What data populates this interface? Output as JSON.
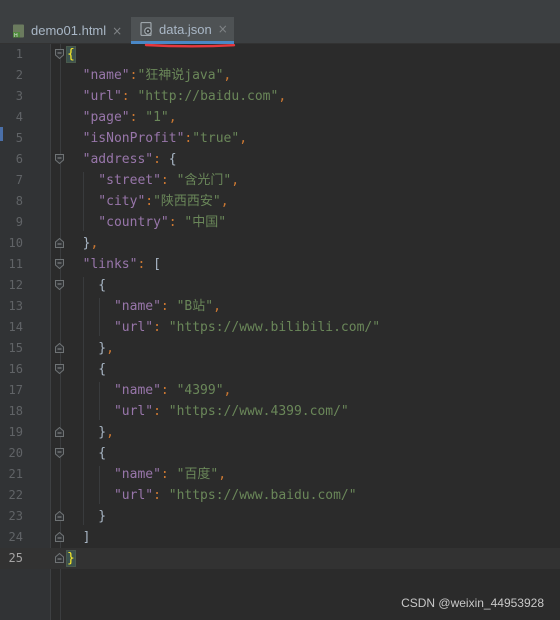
{
  "tabs": [
    {
      "label": "demo01.html",
      "close": "×",
      "icon": "html-file-icon",
      "active": false
    },
    {
      "label": "data.json",
      "close": "×",
      "icon": "json-file-icon",
      "active": true
    }
  ],
  "colors": {
    "background": "#2b2b2b",
    "key": "#9876aa",
    "string": "#6a8759",
    "punctuation": "#cc7832",
    "bracket": "#a9b7c6",
    "line_number": "#606366",
    "accent": "#4a88c7",
    "annotation": "#e8373d"
  },
  "editor": {
    "current_line": 25,
    "lines": [
      {
        "n": "1",
        "fold": "open",
        "tokens": [
          [
            "bm",
            "{"
          ]
        ]
      },
      {
        "n": "2",
        "tokens": [
          [
            "k",
            "  \"name\""
          ],
          [
            "p",
            ":"
          ],
          [
            "s",
            "\"狂神说java\""
          ],
          [
            "p",
            ","
          ]
        ]
      },
      {
        "n": "3",
        "tokens": [
          [
            "k",
            "  \"url\""
          ],
          [
            "p",
            ": "
          ],
          [
            "s",
            "\"http://baidu.com\""
          ],
          [
            "p",
            ","
          ]
        ]
      },
      {
        "n": "4",
        "tokens": [
          [
            "k",
            "  \"page\""
          ],
          [
            "p",
            ": "
          ],
          [
            "s",
            "\"1\""
          ],
          [
            "p",
            ","
          ]
        ]
      },
      {
        "n": "5",
        "tokens": [
          [
            "k",
            "  \"isNonProfit\""
          ],
          [
            "p",
            ":"
          ],
          [
            "s",
            "\"true\""
          ],
          [
            "p",
            ","
          ]
        ]
      },
      {
        "n": "6",
        "fold": "open",
        "tokens": [
          [
            "k",
            "  \"address\""
          ],
          [
            "p",
            ": "
          ],
          [
            "b",
            "{"
          ]
        ]
      },
      {
        "n": "7",
        "tokens": [
          [
            "k",
            "    \"street\""
          ],
          [
            "p",
            ": "
          ],
          [
            "s",
            "\"含光门\""
          ],
          [
            "p",
            ","
          ]
        ]
      },
      {
        "n": "8",
        "tokens": [
          [
            "k",
            "    \"city\""
          ],
          [
            "p",
            ":"
          ],
          [
            "s",
            "\"陕西西安\""
          ],
          [
            "p",
            ","
          ]
        ]
      },
      {
        "n": "9",
        "tokens": [
          [
            "k",
            "    \"country\""
          ],
          [
            "p",
            ": "
          ],
          [
            "s",
            "\"中国\""
          ]
        ]
      },
      {
        "n": "10",
        "fold": "close",
        "tokens": [
          [
            "b",
            "  }"
          ],
          [
            "p",
            ","
          ]
        ]
      },
      {
        "n": "11",
        "fold": "open",
        "tokens": [
          [
            "k",
            "  \"links\""
          ],
          [
            "p",
            ": "
          ],
          [
            "b",
            "["
          ]
        ]
      },
      {
        "n": "12",
        "fold": "open",
        "tokens": [
          [
            "b",
            "    {"
          ]
        ]
      },
      {
        "n": "13",
        "tokens": [
          [
            "k",
            "      \"name\""
          ],
          [
            "p",
            ": "
          ],
          [
            "s",
            "\"B站\""
          ],
          [
            "p",
            ","
          ]
        ]
      },
      {
        "n": "14",
        "tokens": [
          [
            "k",
            "      \"url\""
          ],
          [
            "p",
            ": "
          ],
          [
            "s",
            "\"https://www.bilibili.com/\""
          ]
        ]
      },
      {
        "n": "15",
        "fold": "close",
        "tokens": [
          [
            "b",
            "    }"
          ],
          [
            "p",
            ","
          ]
        ]
      },
      {
        "n": "16",
        "fold": "open",
        "tokens": [
          [
            "b",
            "    {"
          ]
        ]
      },
      {
        "n": "17",
        "tokens": [
          [
            "k",
            "      \"name\""
          ],
          [
            "p",
            ": "
          ],
          [
            "s",
            "\"4399\""
          ],
          [
            "p",
            ","
          ]
        ]
      },
      {
        "n": "18",
        "tokens": [
          [
            "k",
            "      \"url\""
          ],
          [
            "p",
            ": "
          ],
          [
            "s",
            "\"https://www.4399.com/\""
          ]
        ]
      },
      {
        "n": "19",
        "fold": "close",
        "tokens": [
          [
            "b",
            "    }"
          ],
          [
            "p",
            ","
          ]
        ]
      },
      {
        "n": "20",
        "fold": "open",
        "tokens": [
          [
            "b",
            "    {"
          ]
        ]
      },
      {
        "n": "21",
        "tokens": [
          [
            "k",
            "      \"name\""
          ],
          [
            "p",
            ": "
          ],
          [
            "s",
            "\"百度\""
          ],
          [
            "p",
            ","
          ]
        ]
      },
      {
        "n": "22",
        "tokens": [
          [
            "k",
            "      \"url\""
          ],
          [
            "p",
            ": "
          ],
          [
            "s",
            "\"https://www.baidu.com/\""
          ]
        ]
      },
      {
        "n": "23",
        "fold": "close",
        "tokens": [
          [
            "b",
            "    }"
          ]
        ]
      },
      {
        "n": "24",
        "fold": "close",
        "tokens": [
          [
            "b",
            "  ]"
          ]
        ]
      },
      {
        "n": "25",
        "fold": "close",
        "tokens": [
          [
            "bm",
            "}"
          ]
        ]
      }
    ]
  },
  "watermark": "CSDN @weixin_44953928"
}
